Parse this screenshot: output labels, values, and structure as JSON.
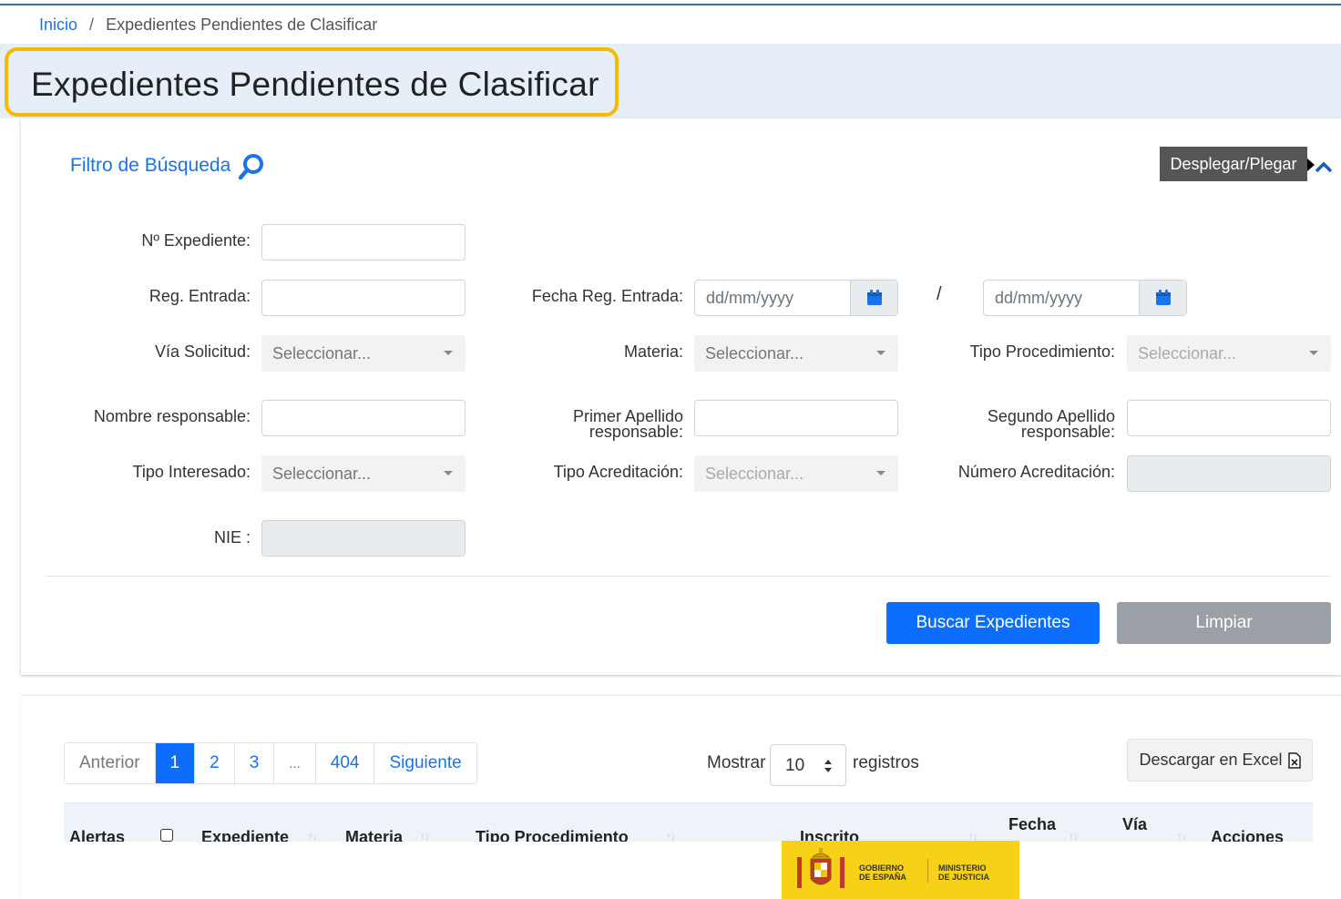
{
  "breadcrumb": {
    "home": "Inicio",
    "separator": "/",
    "current": "Expedientes Pendientes de Clasificar"
  },
  "page_title": "Expedientes Pendientes de Clasificar",
  "filter": {
    "title": "Filtro de Búsqueda",
    "toggle_label": "Desplegar/Plegar",
    "fields": {
      "expediente_label": "Nº Expediente:",
      "reg_entrada_label": "Reg. Entrada:",
      "fecha_reg_label": "Fecha Reg. Entrada:",
      "fecha_desde_placeholder": "dd/mm/yyyy",
      "fecha_hasta_placeholder": "dd/mm/yyyy",
      "date_separator": "/",
      "via_label": "Vía Solicitud:",
      "via_value": "Seleccionar...",
      "materia_label": "Materia:",
      "materia_value": "Seleccionar...",
      "tipo_proc_label": "Tipo Procedimiento:",
      "tipo_proc_value": "Seleccionar...",
      "nombre_label": "Nombre responsable:",
      "apellido1_label_line1": "Primer Apellido",
      "apellido1_label_line2": "responsable:",
      "apellido2_label_line1": "Segundo Apellido",
      "apellido2_label_line2": "responsable:",
      "tipo_interesado_label": "Tipo Interesado:",
      "tipo_interesado_value": "Seleccionar...",
      "tipo_acred_label": "Tipo Acreditación:",
      "tipo_acred_value": "Seleccionar...",
      "num_acred_label": "Número Acreditación:",
      "nie_label": "NIE :"
    },
    "buttons": {
      "search": "Buscar Expedientes",
      "clear": "Limpiar"
    }
  },
  "results": {
    "pagination": {
      "prev": "Anterior",
      "pages": [
        "1",
        "2",
        "3",
        "...",
        "404"
      ],
      "active_page": "1",
      "next": "Siguiente"
    },
    "show_label": "Mostrar",
    "page_size": "10",
    "records_label": "registros",
    "excel_button": "Descargar en Excel",
    "columns": [
      "Alertas",
      "Expediente",
      "Materia",
      "Tipo Procedimiento",
      "Inscrito",
      "Fecha",
      "Vía",
      "Acciones"
    ]
  },
  "footer_logo": {
    "gov_line1": "GOBIERNO",
    "gov_line2": "DE ESPAÑA",
    "min_line1": "MINISTERIO",
    "min_line2": "DE JUSTICIA"
  },
  "colors": {
    "primary": "#0d6efd",
    "highlight": "#f7b800",
    "title_band": "#e6eef7",
    "gov_yellow": "#f7d117"
  }
}
